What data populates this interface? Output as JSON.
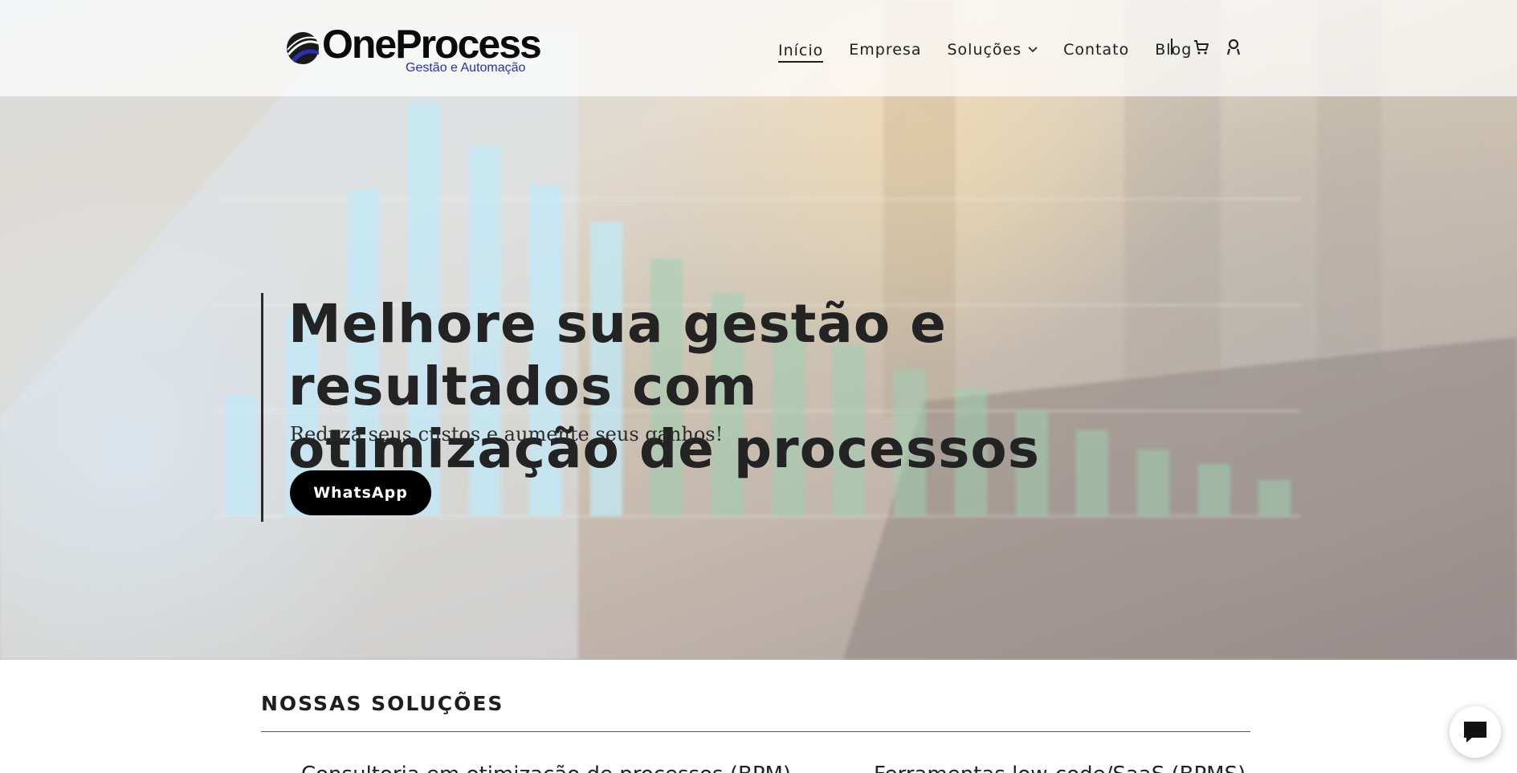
{
  "brand": {
    "name": "OneProcess",
    "tagline": "Gestão e Automação",
    "colors": {
      "logo_blue": "#2b2fb0",
      "text_dark": "#232323",
      "button_black": "#000000"
    }
  },
  "nav": {
    "items": [
      {
        "label": "Início",
        "active": true
      },
      {
        "label": "Empresa",
        "active": false
      },
      {
        "label": "Soluções",
        "active": false,
        "has_dropdown": true
      },
      {
        "label": "Contato",
        "active": false
      },
      {
        "label": "Blog",
        "active": false
      }
    ],
    "icons": [
      "cart-icon",
      "user-icon"
    ]
  },
  "hero": {
    "title": "Melhore sua gestão e resultados com otimização de processos",
    "subtitle": "Reduza seus custos e aumente seus ganhos!",
    "cta_label": "WhatsApp"
  },
  "solutions": {
    "heading": "NOSSAS SOLUÇÕES",
    "items": [
      "Consultoria em otimização de processos (BPM)",
      "Ferramentas low-code/SaaS (BPMS)"
    ]
  },
  "chat": {
    "icon": "chat-bubble-icon"
  }
}
